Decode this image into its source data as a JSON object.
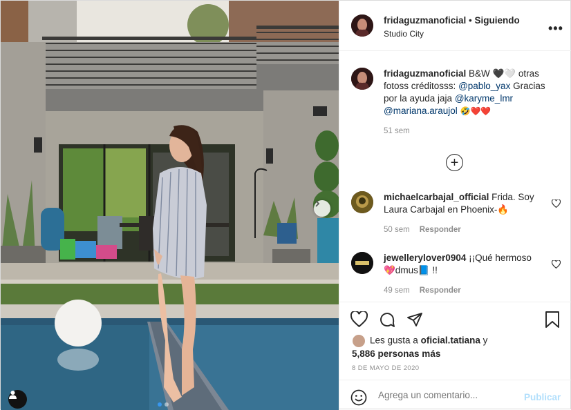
{
  "header": {
    "username": "fridaguzmanoficial",
    "separator": "•",
    "follow_status": "Siguiendo",
    "location": "Studio City",
    "more": "•••"
  },
  "caption": {
    "username": "fridaguzmanoficial",
    "text_1": "B&W 🖤🤍 otras fotoss créditosss:",
    "mention_1": "@pablo_yax",
    "text_2": "Gracias por la ayuda jaja",
    "mention_2": "@karyme_lmr",
    "mention_3": "@mariana.araujol",
    "text_3": "🤣❤️❤️",
    "time": "51 sem"
  },
  "load_more_label": "+",
  "comments": [
    {
      "username": "michaelcarbajal_official",
      "text": "Frida. Soy Laura Carbajal en Phoenix-🔥",
      "time": "50 sem",
      "reply": "Responder"
    },
    {
      "username": "jewellerylover0904",
      "text": "¡¡Qué hermoso 💖dmus📘 !!",
      "time": "49 sem",
      "reply": "Responder"
    }
  ],
  "likes": {
    "line1_prefix": "Les gusta a",
    "liker": "oficial.tatiana",
    "line1_suffix": "y",
    "line2": "5,886 personas más"
  },
  "date": "8 DE MAYO DE 2020",
  "add_comment": {
    "placeholder": "Agrega un comentario...",
    "publish": "Publicar"
  },
  "icons": {
    "like": "heart-icon",
    "comment": "comment-icon",
    "share": "paper-plane-icon",
    "save": "bookmark-icon",
    "emoji": "smiley-icon",
    "next": "chevron-right-icon",
    "tag": "user-tag-icon"
  },
  "colors": {
    "link": "#00376b",
    "publish_disabled": "#b2dffc",
    "muted": "#8e8e8e",
    "carousel_active_dot": "#3897f0"
  }
}
